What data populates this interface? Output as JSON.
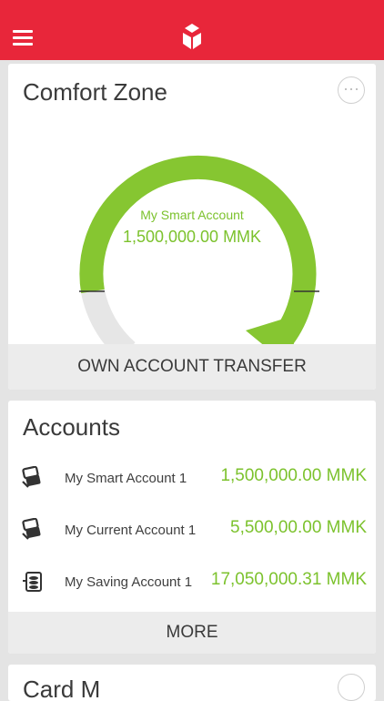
{
  "header": {
    "menu_icon": "hamburger-icon",
    "logo_icon": "bank-logo-icon",
    "bg_color": "#e8263a"
  },
  "comfort_zone": {
    "title": "Comfort Zone",
    "more_label": "···",
    "account_name": "My Smart Account",
    "amount": "1,500,000.00",
    "currency": "MMK",
    "action_label": "OWN ACCOUNT TRANSFER",
    "gauge_fill_fraction": 0.8,
    "accent_color": "#7cc22d"
  },
  "accounts": {
    "title": "Accounts",
    "items": [
      {
        "name": "My Smart Account 1",
        "amount": "1,500,000.00",
        "currency": "MMK",
        "icon": "money-transfer-icon"
      },
      {
        "name": "My Current Account 1",
        "amount": "5,500,00.00",
        "currency": "MMK",
        "icon": "money-transfer-icon"
      },
      {
        "name": "My Saving Account 1",
        "amount": "17,050,000.31",
        "currency": "MMK",
        "icon": "savings-icon"
      }
    ],
    "more_label": "MORE"
  },
  "next_card": {
    "title": "Card M"
  }
}
